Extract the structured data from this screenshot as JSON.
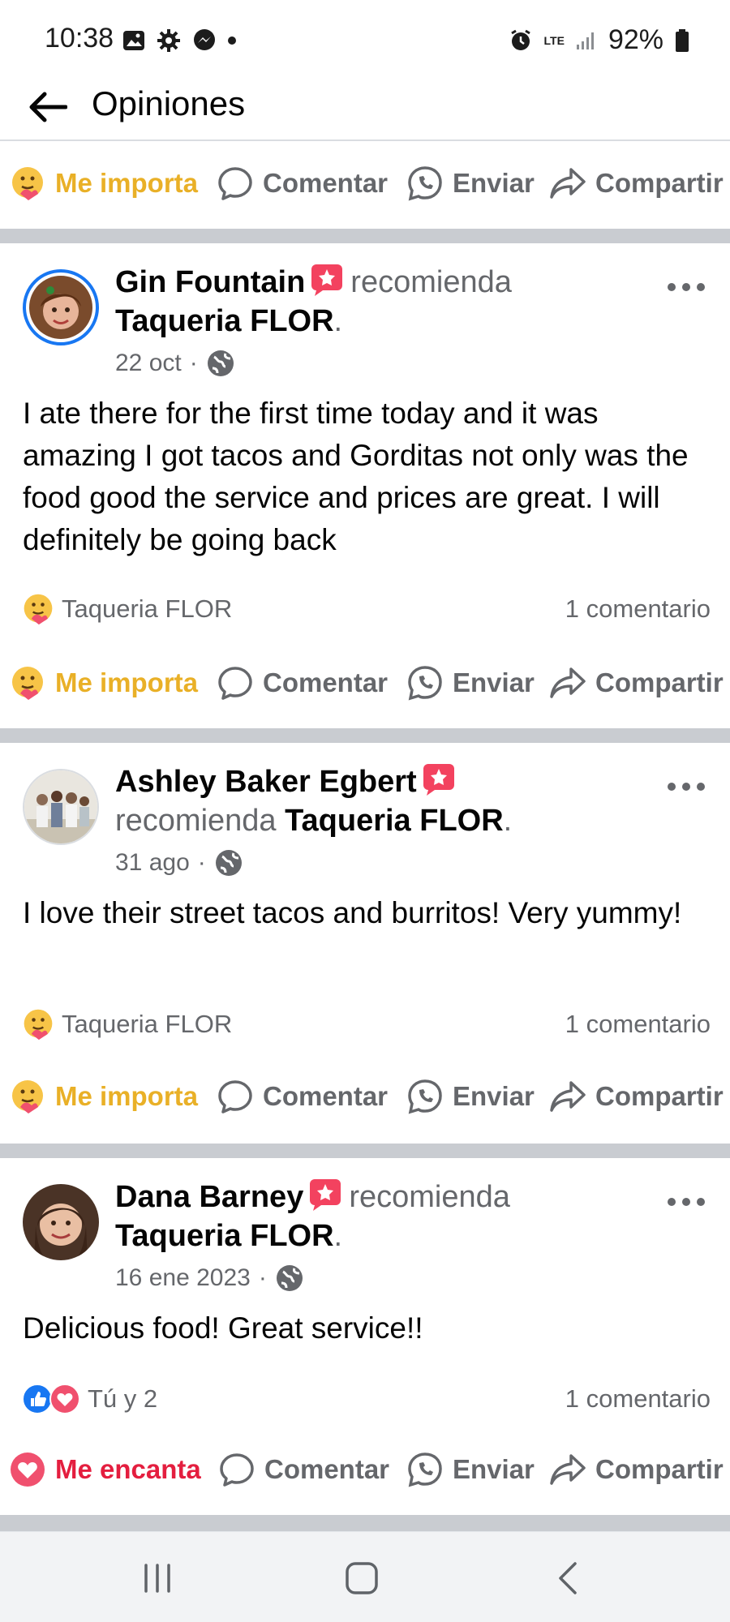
{
  "status_bar": {
    "time": "10:38",
    "network": "LTE",
    "battery": "92%",
    "left_icons": [
      "gallery-icon",
      "settings-icon",
      "messenger-icon",
      "dot-icon"
    ],
    "right_icons": [
      "alarm-icon",
      "lte-icon",
      "signal-icon",
      "battery-icon"
    ]
  },
  "header": {
    "title": "Opiniones",
    "back_icon": "arrow-left-icon"
  },
  "actions": {
    "like_care": "Me importa",
    "like_love": "Me encanta",
    "comment": "Comentar",
    "send": "Enviar",
    "share": "Compartir"
  },
  "posts": [
    {
      "author": "Gin Fountain",
      "recommends": "recomienda",
      "page": "Taqueria FLOR",
      "date": "22 oct",
      "text": "I ate there for the first time today and it was amazing I got tacos and Gorditas not only was the food good the service and prices are great. I will definitely be going back",
      "reactions_label": "Taqueria FLOR",
      "comments": "1 comentario",
      "reaction": "care"
    },
    {
      "author": "Ashley Baker Egbert",
      "recommends": "recomienda",
      "page": "Taqueria FLOR",
      "date": "31 ago",
      "text": "I love their street tacos and burritos! Very yummy!",
      "reactions_label": "Taqueria FLOR",
      "comments": "1 comentario",
      "reaction": "care"
    },
    {
      "author": "Dana Barney",
      "recommends": "recomienda",
      "page": "Taqueria FLOR",
      "date": "16 ene 2023",
      "text": "Delicious food! Great service!!",
      "reactions_label": "Tú y 2",
      "comments": "1 comentario",
      "reaction": "love"
    }
  ],
  "colors": {
    "care": "#e9b027",
    "love": "#e41e3f",
    "facebook_blue": "#1877f2",
    "muted": "#65676b",
    "separator": "#c9ccd1"
  }
}
